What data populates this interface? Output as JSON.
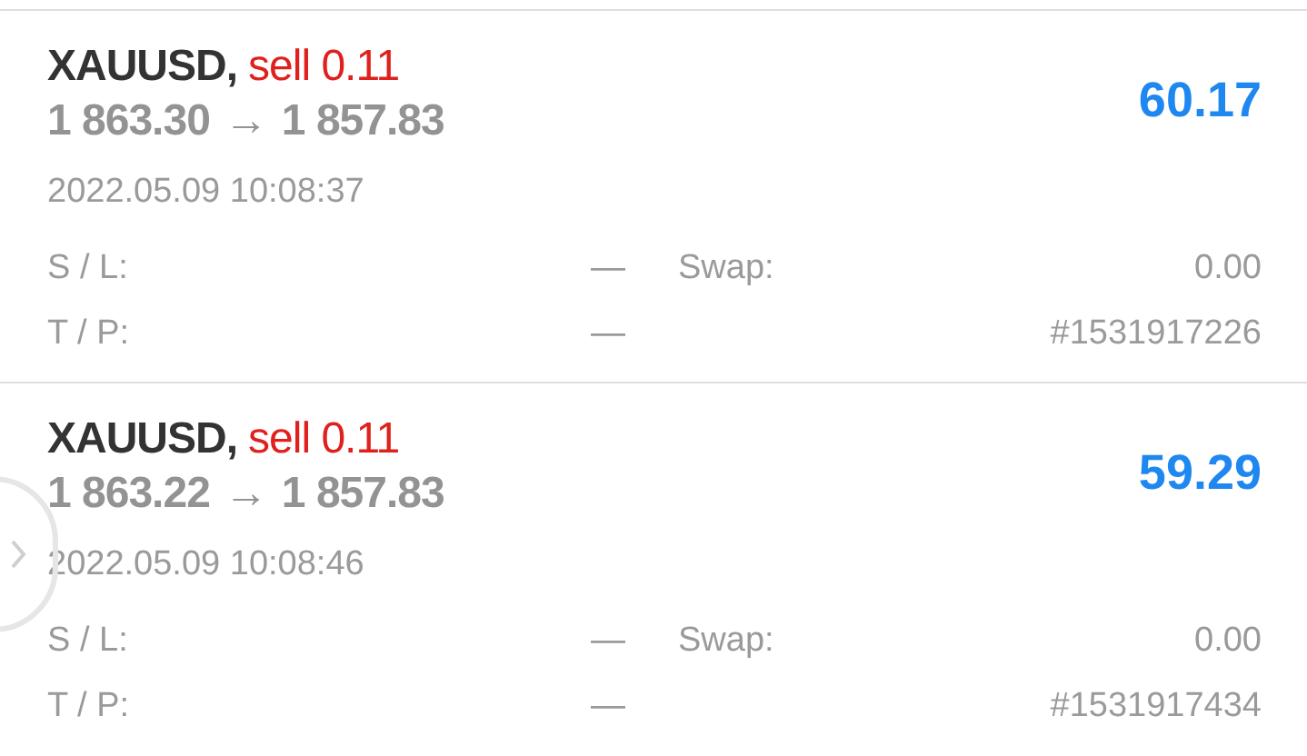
{
  "positions": [
    {
      "symbol": "XAUUSD,",
      "kind": "sell",
      "trade": "sell 0.11",
      "open_price": "1 863.30",
      "arrow": "→",
      "current_price": "1 857.83",
      "profit": "60.17",
      "time": "2022.05.09 10:08:37",
      "sl_label": "S / L:",
      "sl_value": "—",
      "tp_label": "T / P:",
      "tp_value": "—",
      "swap_label": "Swap:",
      "swap_value": "0.00",
      "ticket": "#1531917226"
    },
    {
      "symbol": "XAUUSD,",
      "kind": "sell",
      "trade": "sell 0.11",
      "open_price": "1 863.22",
      "arrow": "→",
      "current_price": "1 857.83",
      "profit": "59.29",
      "time": "2022.05.09 10:08:46",
      "sl_label": "S / L:",
      "sl_value": "—",
      "tp_label": "T / P:",
      "tp_value": "—",
      "swap_label": "Swap:",
      "swap_value": "0.00",
      "ticket": "#1531917434"
    }
  ]
}
